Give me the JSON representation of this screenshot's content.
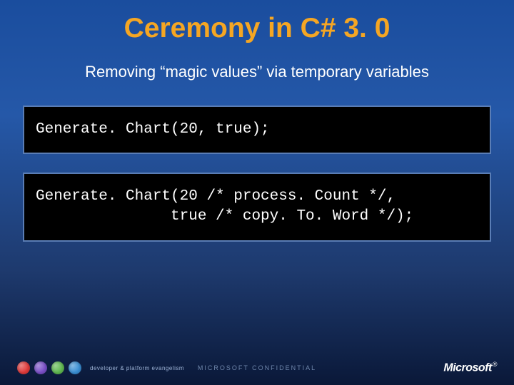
{
  "title": "Ceremony in C# 3. 0",
  "subtitle": "Removing “magic values” via temporary variables",
  "code1": "Generate. Chart(20, true);",
  "code2": "Generate. Chart(20 /* process. Count */,\n               true /* copy. To. Word */);",
  "footer": {
    "brand": "developer & platform evangelism",
    "confidential": "MICROSOFT CONFIDENTIAL",
    "company": "Microsoft"
  }
}
